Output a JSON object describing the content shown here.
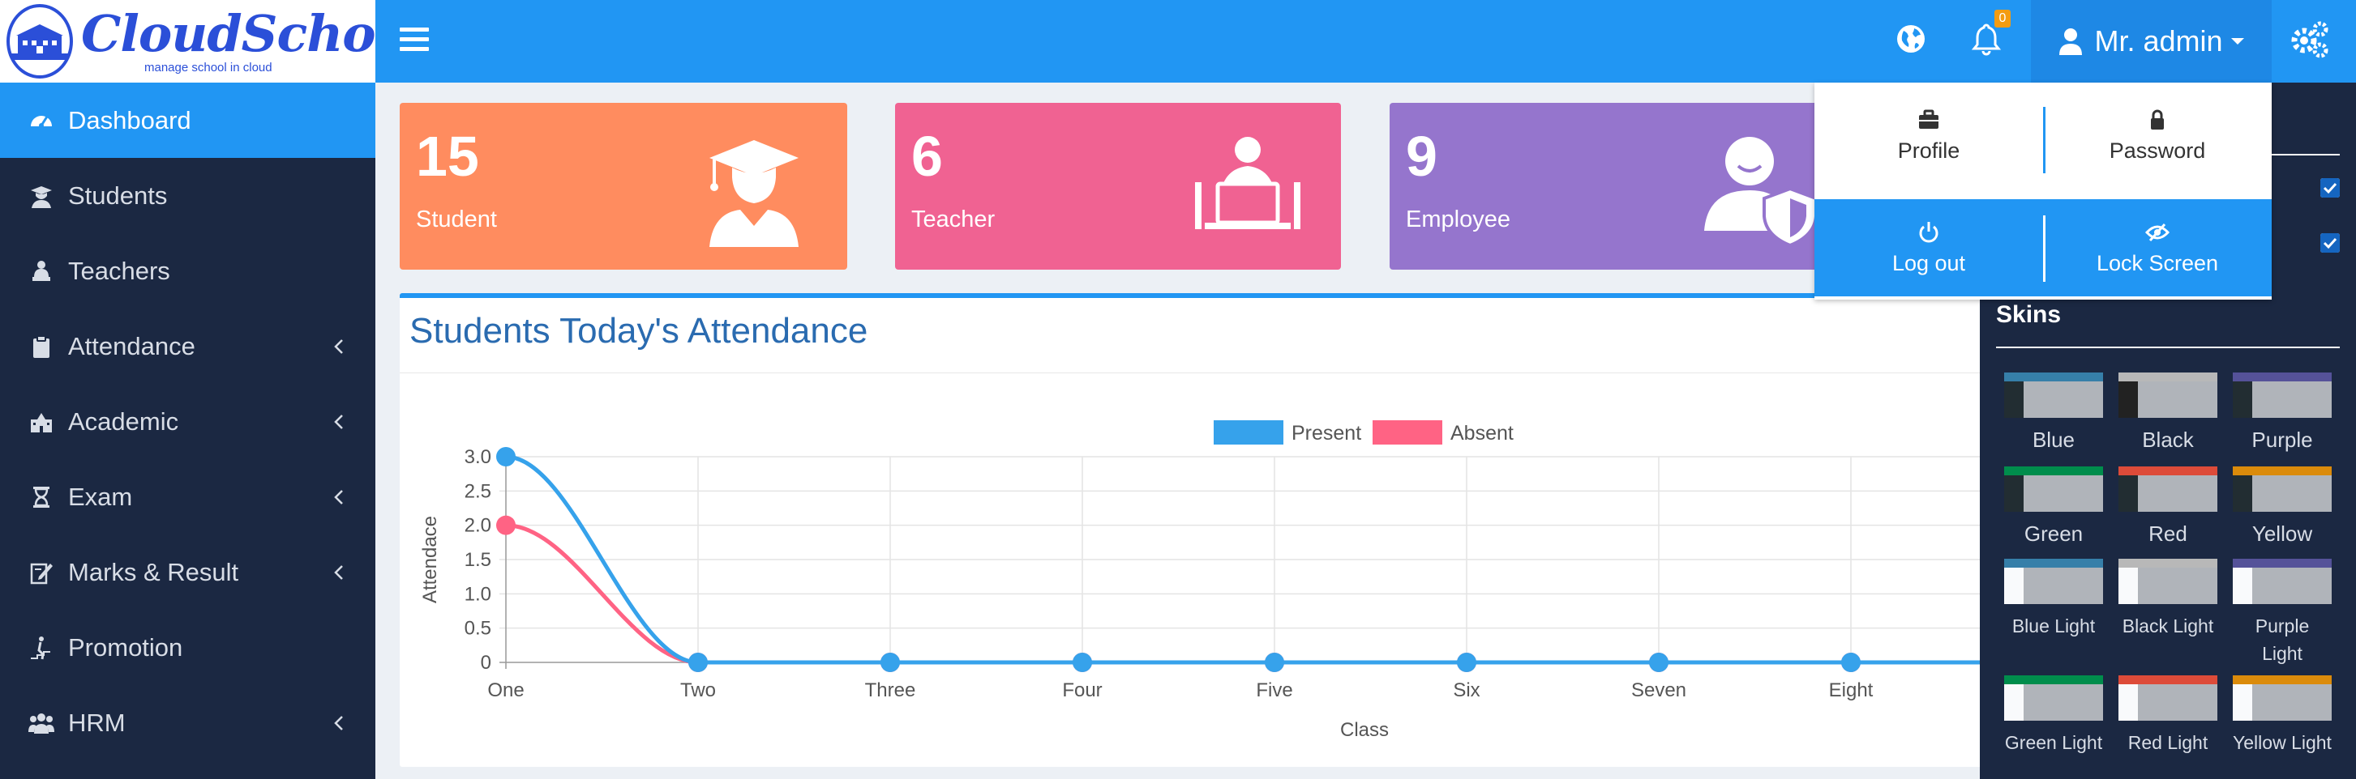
{
  "logo": {
    "name": "CloudSchool",
    "tagline": "manage school in cloud"
  },
  "sidebar": {
    "items": [
      {
        "label": "Dashboard",
        "icon": "dashboard-icon",
        "active": true,
        "has_children": false
      },
      {
        "label": "Students",
        "icon": "student-icon",
        "active": false,
        "has_children": false
      },
      {
        "label": "Teachers",
        "icon": "teacher-icon",
        "active": false,
        "has_children": false
      },
      {
        "label": "Attendance",
        "icon": "clipboard-icon",
        "active": false,
        "has_children": true
      },
      {
        "label": "Academic",
        "icon": "school-building-icon",
        "active": false,
        "has_children": true
      },
      {
        "label": "Exam",
        "icon": "hourglass-icon",
        "active": false,
        "has_children": true
      },
      {
        "label": "Marks & Result",
        "icon": "edit-document-icon",
        "active": false,
        "has_children": true
      },
      {
        "label": "Promotion",
        "icon": "stairs-walk-icon",
        "active": false,
        "has_children": false
      },
      {
        "label": "HRM",
        "icon": "users-group-icon",
        "active": false,
        "has_children": true
      }
    ]
  },
  "topbar": {
    "notification_count": "0",
    "user_name": "Mr. admin",
    "icons": [
      "menu-icon",
      "globe-icon",
      "bell-icon",
      "user-icon",
      "gears-icon"
    ]
  },
  "stats": [
    {
      "value": "15",
      "label": "Student",
      "color": "#ff8c5f",
      "icon": "graduate-icon"
    },
    {
      "value": "6",
      "label": "Teacher",
      "color": "#f06292",
      "icon": "teacher-laptop-icon"
    },
    {
      "value": "9",
      "label": "Employee",
      "color": "#9575cd",
      "icon": "employee-shield-icon"
    }
  ],
  "attendance": {
    "title": "Students Today's Attendance"
  },
  "chart_data": {
    "type": "line",
    "title": "",
    "xlabel": "Class",
    "ylabel": "Attendace",
    "categories": [
      "One",
      "Two",
      "Three",
      "Four",
      "Five",
      "Six",
      "Seven",
      "Eight"
    ],
    "ylim": [
      0,
      3
    ],
    "yticks": [
      "0",
      "0.5",
      "1.0",
      "1.5",
      "2.0",
      "2.5",
      "3.0"
    ],
    "legend_position": "top-center",
    "grid": true,
    "series": [
      {
        "name": "Present",
        "color": "#36a2eb",
        "values": [
          3,
          0,
          0,
          0,
          0,
          0,
          0,
          0
        ]
      },
      {
        "name": "Absent",
        "color": "#ff6384",
        "values": [
          2,
          0,
          0,
          0,
          0,
          0,
          0,
          0
        ]
      }
    ]
  },
  "dropdown": {
    "profile": "Profile",
    "password": "Password",
    "logout": "Log out",
    "lock": "Lock Screen"
  },
  "control_sidebar": {
    "skins_title": "Skins",
    "skins": [
      {
        "label": "Blue",
        "bar": "#367fa9",
        "side": "#222d32",
        "small": false
      },
      {
        "label": "Black",
        "bar": "#b8b8b8",
        "side": "#222222",
        "small": false
      },
      {
        "label": "Purple",
        "bar": "#555299",
        "side": "#222d32",
        "small": false
      },
      {
        "label": "Green",
        "bar": "#008d4c",
        "side": "#222d32",
        "small": false
      },
      {
        "label": "Red",
        "bar": "#dd4b39",
        "side": "#222d32",
        "small": false
      },
      {
        "label": "Yellow",
        "bar": "#db8b0b",
        "side": "#222d32",
        "small": false
      },
      {
        "label": "Blue Light",
        "bar": "#367fa9",
        "side": "#f9fafc",
        "small": true
      },
      {
        "label": "Black Light",
        "bar": "#b8b8b8",
        "side": "#f9fafc",
        "small": true
      },
      {
        "label": "Purple Light",
        "bar": "#555299",
        "side": "#f9fafc",
        "small": true
      },
      {
        "label": "Green Light",
        "bar": "#008d4c",
        "side": "#f9fafc",
        "small": true
      },
      {
        "label": "Red Light",
        "bar": "#dd4b39",
        "side": "#f9fafc",
        "small": true
      },
      {
        "label": "Yellow Light",
        "bar": "#db8b0b",
        "side": "#f9fafc",
        "small": true
      }
    ]
  }
}
